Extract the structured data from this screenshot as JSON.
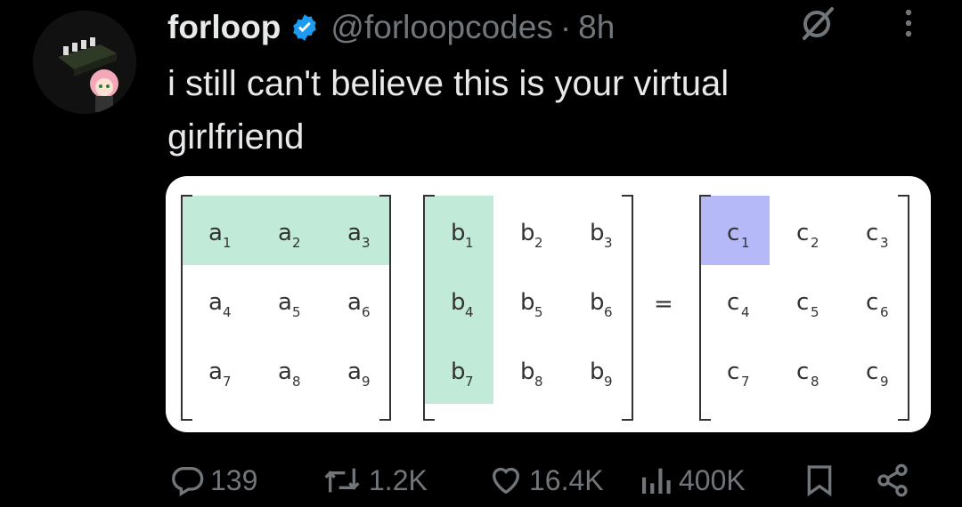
{
  "post": {
    "author": {
      "name": "forloop",
      "handle": "@forloopcodes",
      "verified": true,
      "avatar_icon": "anime-girl-avatar-icon"
    },
    "separator": "·",
    "time": "8h",
    "text": "i still can't believe this is your virtual girlfriend",
    "colors": {
      "background": "#000000",
      "text": "#e7e9ea",
      "muted": "#71767b",
      "verified": "#1d9bf0",
      "highlight_green": "#c2ead9",
      "highlight_blue": "#b6b9f8"
    }
  },
  "matrix_image": {
    "A": [
      [
        "a",
        "1"
      ],
      [
        "a",
        "2"
      ],
      [
        "a",
        "3"
      ],
      [
        "a",
        "4"
      ],
      [
        "a",
        "5"
      ],
      [
        "a",
        "6"
      ],
      [
        "a",
        "7"
      ],
      [
        "a",
        "8"
      ],
      [
        "a",
        "9"
      ]
    ],
    "B": [
      [
        "b",
        "1"
      ],
      [
        "b",
        "2"
      ],
      [
        "b",
        "3"
      ],
      [
        "b",
        "4"
      ],
      [
        "b",
        "5"
      ],
      [
        "b",
        "6"
      ],
      [
        "b",
        "7"
      ],
      [
        "b",
        "8"
      ],
      [
        "b",
        "9"
      ]
    ],
    "C": [
      [
        "c",
        "1"
      ],
      [
        "c",
        "2"
      ],
      [
        "c",
        "3"
      ],
      [
        "c",
        "4"
      ],
      [
        "c",
        "5"
      ],
      [
        "c",
        "6"
      ],
      [
        "c",
        "7"
      ],
      [
        "c",
        "8"
      ],
      [
        "c",
        "9"
      ]
    ],
    "equals": "=",
    "highlight": {
      "A": "row 1",
      "B": "column 1",
      "C": "c1"
    }
  },
  "actions": {
    "replies": "139",
    "reposts": "1.2K",
    "likes": "16.4K",
    "views": "400K"
  }
}
